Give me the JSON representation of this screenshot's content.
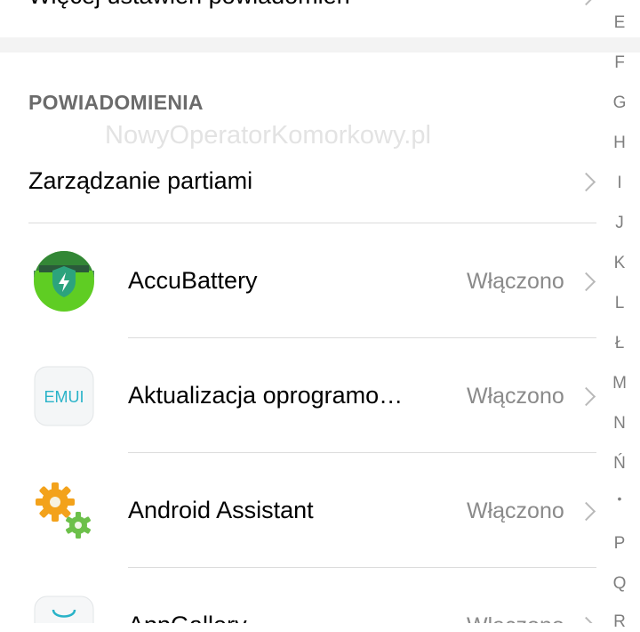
{
  "top_row": {
    "label": "Więcej ustawień powiadomień"
  },
  "watermark": "NowyOperatorKomorkowy.pl",
  "section": {
    "header": "POWIADOMIENIA"
  },
  "batch": {
    "label": "Zarządzanie partiami"
  },
  "apps": [
    {
      "name": "AccuBattery",
      "status": "Włączono",
      "icon": "accubattery-icon"
    },
    {
      "name": "Aktualizacja oprogramo…",
      "status": "Włączono",
      "icon": "emui-update-icon",
      "icon_text": "EMUI"
    },
    {
      "name": "Android Assistant",
      "status": "Włączono",
      "icon": "gears-icon"
    },
    {
      "name": "AppGallery",
      "status": "Włączono",
      "icon": "appgallery-icon"
    }
  ],
  "alpha_index": [
    "E",
    "F",
    "G",
    "H",
    "I",
    "J",
    "K",
    "L",
    "Ł",
    "M",
    "N",
    "Ń",
    "•",
    "P",
    "Q",
    "R"
  ],
  "colors": {
    "section_header": "#6b6b6b",
    "status_text": "#8a8a8a",
    "divider": "#dcdcdc",
    "accubattery_green": "#5fcd23",
    "emui_teal": "#29b3c8"
  }
}
